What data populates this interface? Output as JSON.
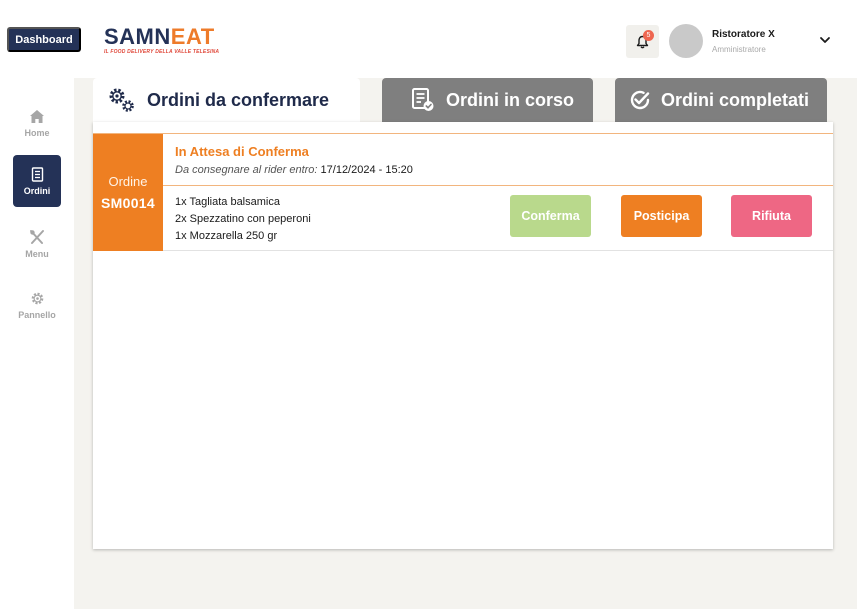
{
  "header": {
    "dashboard_label": "Dashboard",
    "logo_main_a": "SAMN",
    "logo_main_b": "EAT",
    "logo_tagline": "IL FOOD DELIVERY DELLA VALLE TELESINA",
    "notifications_count": "5",
    "user_name": "Ristoratore X",
    "user_role": "Amministratore"
  },
  "sidebar": {
    "items": [
      {
        "label": "Home",
        "icon": "home-icon",
        "active": false
      },
      {
        "label": "Ordini",
        "icon": "orders-list-icon",
        "active": true
      },
      {
        "label": "Menu",
        "icon": "cutlery-icon",
        "active": false
      },
      {
        "label": "Pannello",
        "icon": "gear-icon",
        "active": false
      }
    ]
  },
  "tabs": [
    {
      "label": "Ordini da confermare",
      "icon": "gears-icon",
      "active": true
    },
    {
      "label": "Ordini in corso",
      "icon": "receipt-check-icon",
      "active": false
    },
    {
      "label": "Ordini completati",
      "icon": "check-circle-icon",
      "active": false
    }
  ],
  "order": {
    "label": "Ordine",
    "code": "SM0014",
    "status": "In Attesa di Conferma",
    "deliver_label": "Da consegnare al rider entro:",
    "deliver_time": "17/12/2024 - 15:20",
    "items": [
      "1x Tagliata balsamica",
      "2x Spezzatino con peperoni",
      "1x Mozzarella 250 gr"
    ],
    "actions": {
      "confirm": "Conferma",
      "postpone": "Posticipa",
      "reject": "Rifiuta"
    }
  },
  "colors": {
    "navy": "#243257",
    "orange": "#ee7f22",
    "confirm_green": "#b9d98c",
    "reject_pink": "#ee6784",
    "tab_gray": "#7f7f7f"
  }
}
